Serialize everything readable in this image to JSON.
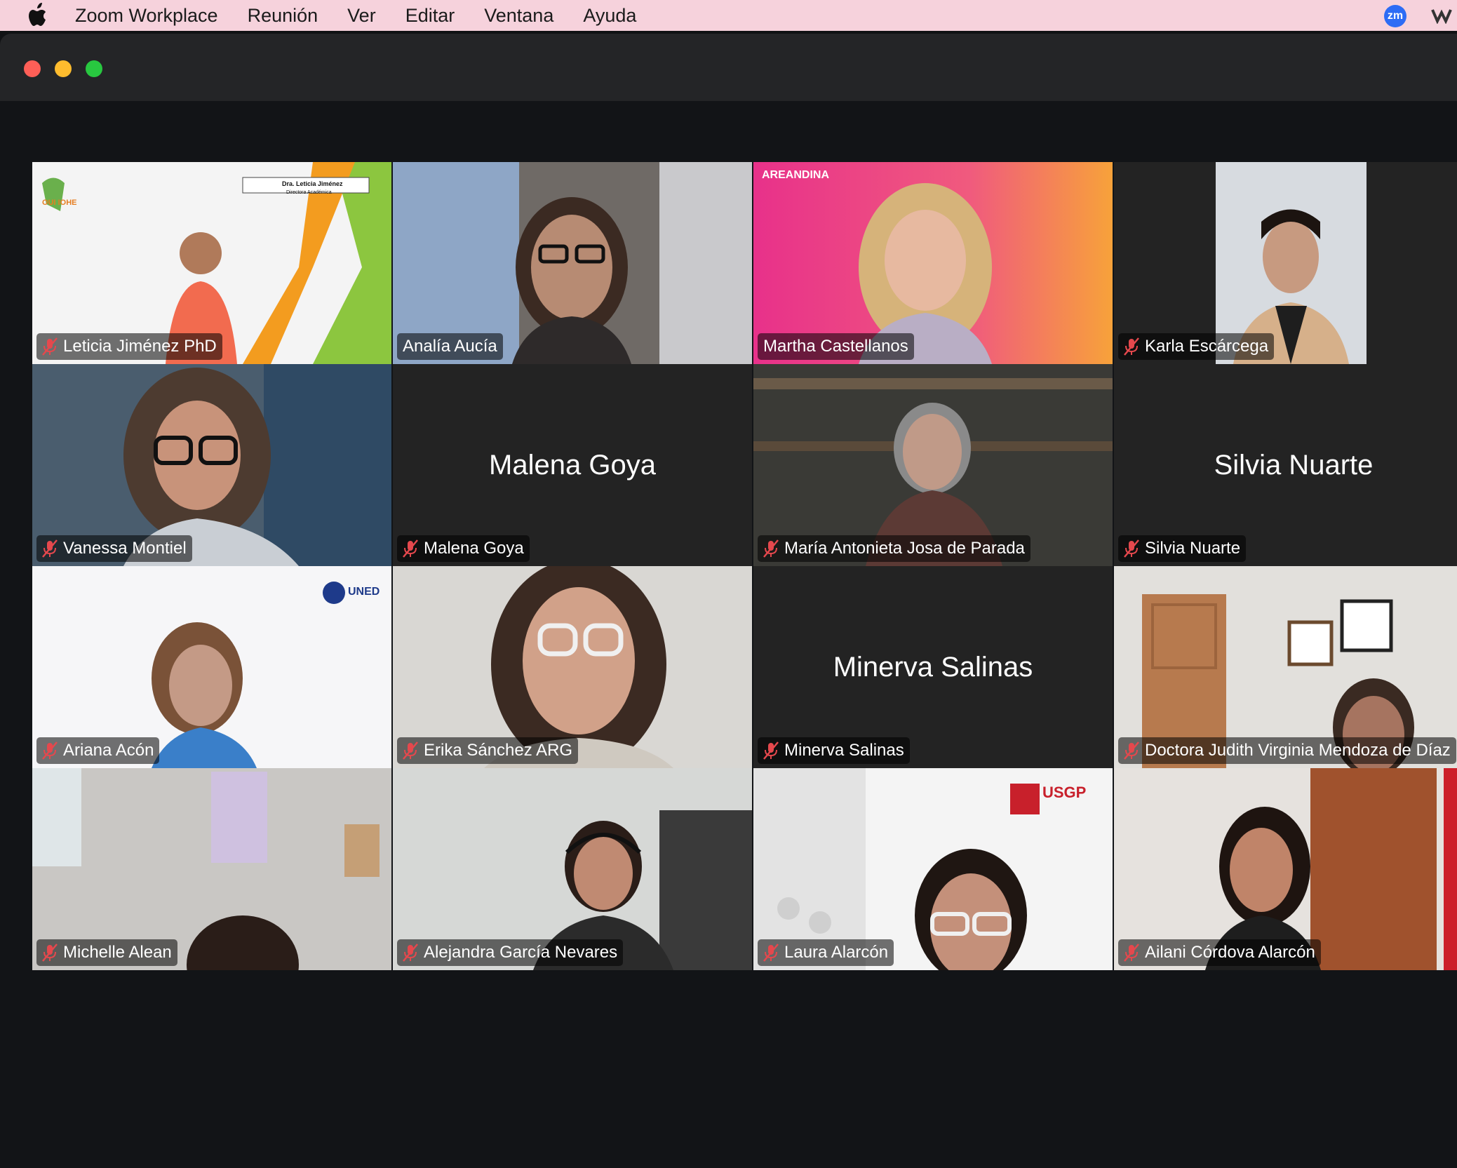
{
  "menubar": {
    "app": "Zoom Workplace",
    "items": [
      "Reunión",
      "Ver",
      "Editar",
      "Ventana",
      "Ayuda"
    ],
    "status_badge": "zm"
  },
  "window": {
    "controls": [
      "close-icon",
      "minimize-icon",
      "zoom-icon"
    ]
  },
  "participants": [
    {
      "name": "Leticia Jiménez PhD",
      "muted": true
    },
    {
      "name": "Analía Aucía",
      "muted": false,
      "speaking": true
    },
    {
      "name": "Martha Castellanos",
      "muted": false
    },
    {
      "name": "Karla Escárcega",
      "muted": true
    },
    {
      "name": "Vanessa Montiel",
      "muted": true
    },
    {
      "name": "Malena Goya",
      "muted": true,
      "video_off": true
    },
    {
      "name": "María Antonieta Josa de Parada",
      "muted": true
    },
    {
      "name": "Silvia Nuarte",
      "muted": true,
      "video_off": true
    },
    {
      "name": "Ariana Acón",
      "muted": true
    },
    {
      "name": "Erika Sánchez ARG",
      "muted": true
    },
    {
      "name": "Minerva Salinas",
      "muted": true,
      "video_off": true
    },
    {
      "name": "Doctora Judith Virginia Mendoza de Díaz",
      "muted": true
    },
    {
      "name": "Michelle Alean",
      "muted": true
    },
    {
      "name": "Alejandra García Nevares",
      "muted": true
    },
    {
      "name": "Laura Alarcón",
      "muted": true
    },
    {
      "name": "Ailani Córdova Alarcón",
      "muted": true
    }
  ],
  "backgrounds": {
    "t1_banner": "Dra. Leticia Jiménez",
    "t1_banner_sub": "Directora Académica",
    "t1_logo": "OUI IOHE",
    "t3_logo": "AREANDINA",
    "t9_logo": "UNED",
    "t15_logo": "USGP"
  },
  "colors": {
    "accent_speaking": "#39c05a",
    "muted_icon": "#e5484d",
    "menubar_bg": "#f6d2dc"
  }
}
